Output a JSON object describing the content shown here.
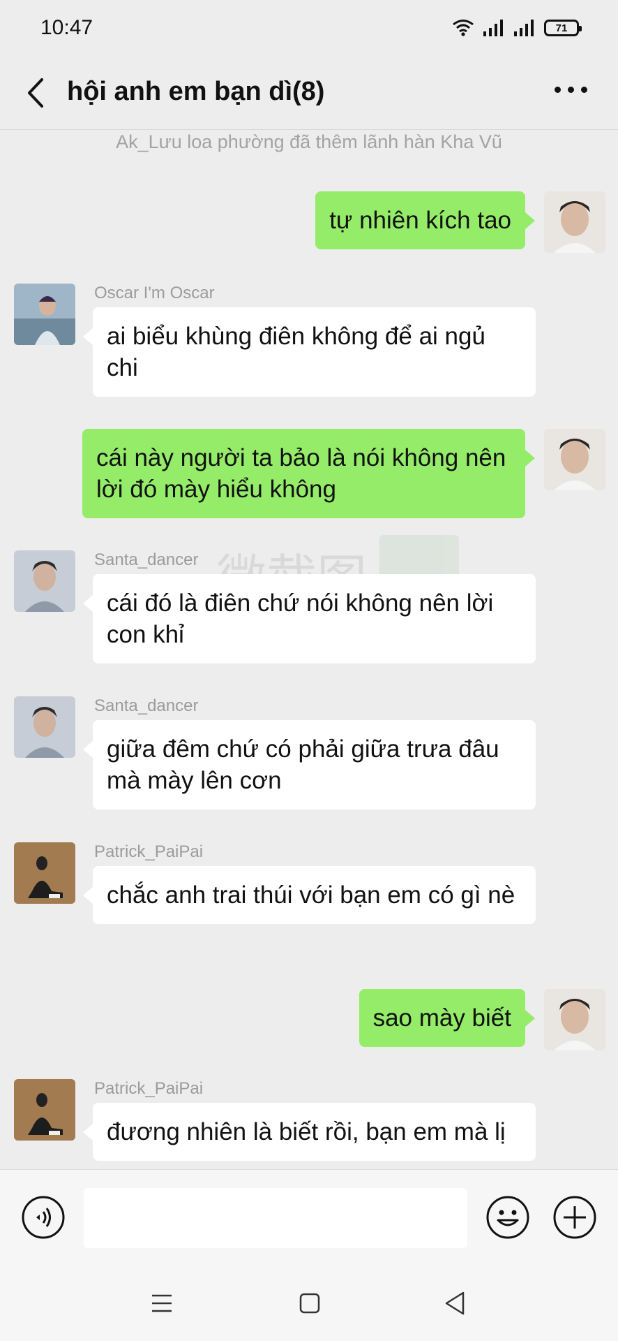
{
  "status": {
    "time": "10:47",
    "battery": "71",
    "icons": [
      "wifi-icon",
      "signal-icon",
      "signal-icon",
      "battery-icon"
    ]
  },
  "header": {
    "title": "hội anh em bạn dì(8)",
    "back_icon": "chevron-left-icon",
    "more_icon": "more-dots-icon"
  },
  "chat": {
    "system_message": "Ak_Lưu loa phường đã thêm lãnh hàn Kha Vũ",
    "messages": [
      {
        "side": "right",
        "sender": "",
        "text": "tự nhiên kích tao"
      },
      {
        "side": "left",
        "sender": "Oscar I'm Oscar",
        "text": "ai biểu khùng điên không để ai ngủ chi"
      },
      {
        "side": "right",
        "sender": "",
        "text": "cái này người ta bảo là nói không nên lời đó mày hiểu không"
      },
      {
        "side": "left",
        "sender": "Santa_dancer",
        "text": "cái đó là điên chứ nói không nên lời con khỉ"
      },
      {
        "side": "left",
        "sender": "Santa_dancer",
        "text": "giữa đêm chứ có phải giữa trưa đâu mà mày lên cơn"
      },
      {
        "side": "left",
        "sender": "Patrick_PaiPai",
        "text": "chắc anh trai thúi với bạn em có gì nè"
      },
      {
        "side": "right",
        "sender": "",
        "text": "sao mày biết"
      },
      {
        "side": "left",
        "sender": "Patrick_PaiPai",
        "text": "đương nhiên là biết rồi, bạn em mà lị"
      }
    ],
    "watermark": "微截图"
  },
  "input_bar": {
    "placeholder": "",
    "icons": [
      "voice-icon",
      "emoji-icon",
      "plus-icon"
    ]
  },
  "nav_bar": {
    "icons": [
      "menu-icon",
      "home-icon",
      "back-triangle-icon"
    ]
  },
  "colors": {
    "background": "#ededed",
    "my_bubble": "#95ec69",
    "other_bubble": "#ffffff",
    "sender_name": "#9b9b9b"
  }
}
